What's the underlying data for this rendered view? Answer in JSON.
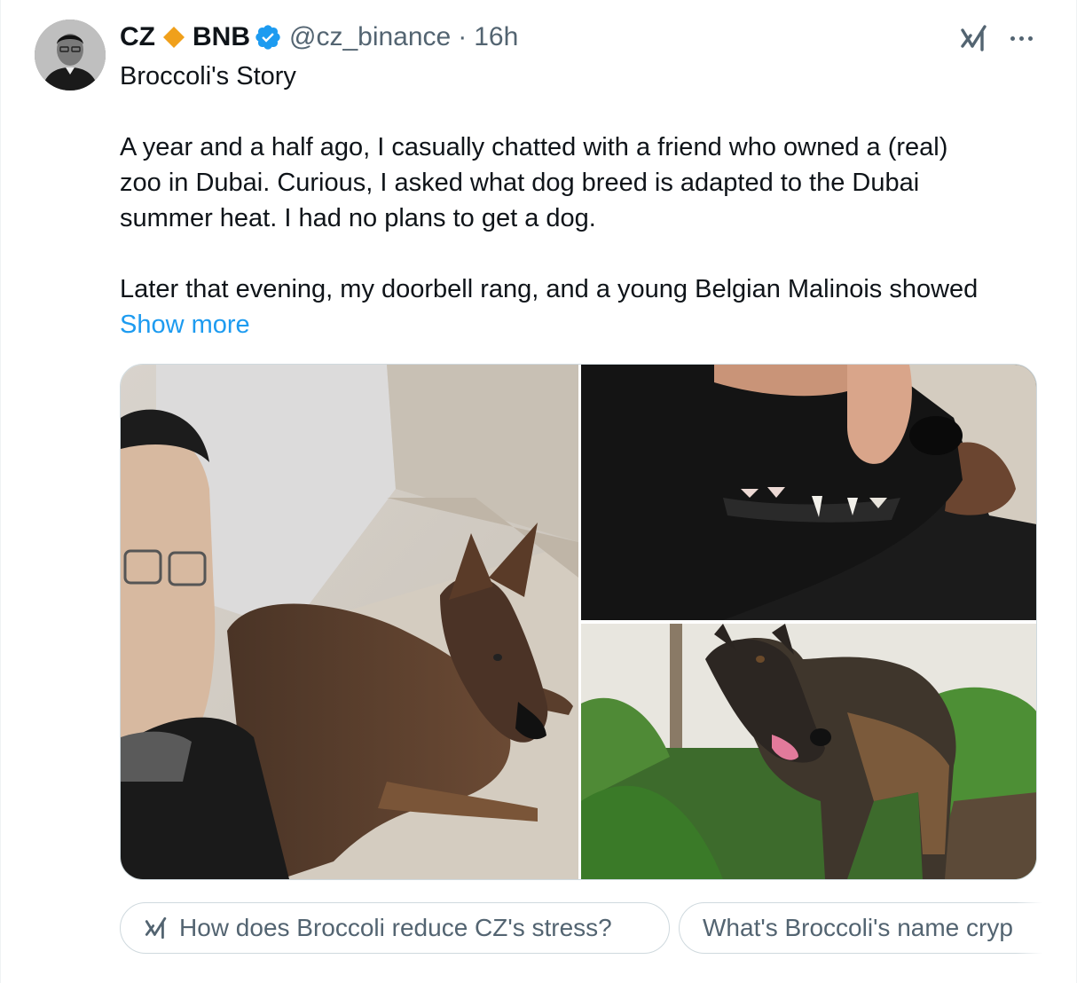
{
  "author": {
    "name": "CZ",
    "badge_text": "BNB",
    "handle": "@cz_binance",
    "separator": "·",
    "time": "16h",
    "avatar_icon": "user-avatar",
    "diamond_color": "#f0b90b",
    "verified_color": "#1d9bf0"
  },
  "tweet": {
    "lines": [
      "Broccoli's Story",
      "",
      "A year and a half ago, I casually chatted with a friend who owned a (real)",
      "zoo in Dubai. Curious, I asked what dog breed is adapted to the Dubai",
      "summer heat. I had no plans to get a dog.",
      "",
      "Later that evening, my doorbell rang, and a young Belgian Malinois showed"
    ],
    "show_more": "Show more",
    "link_color": "#1d9bf0"
  },
  "media": {
    "photos": [
      {
        "desc": "man-selfie-with-dog-on-sofa"
      },
      {
        "desc": "dog-teeth-closeup"
      },
      {
        "desc": "dog-standing-by-bushes"
      }
    ]
  },
  "grok": {
    "icon": "grok-icon",
    "suggestions": [
      "How does Broccoli reduce CZ's stress?",
      "What's Broccoli's name cryp"
    ]
  }
}
